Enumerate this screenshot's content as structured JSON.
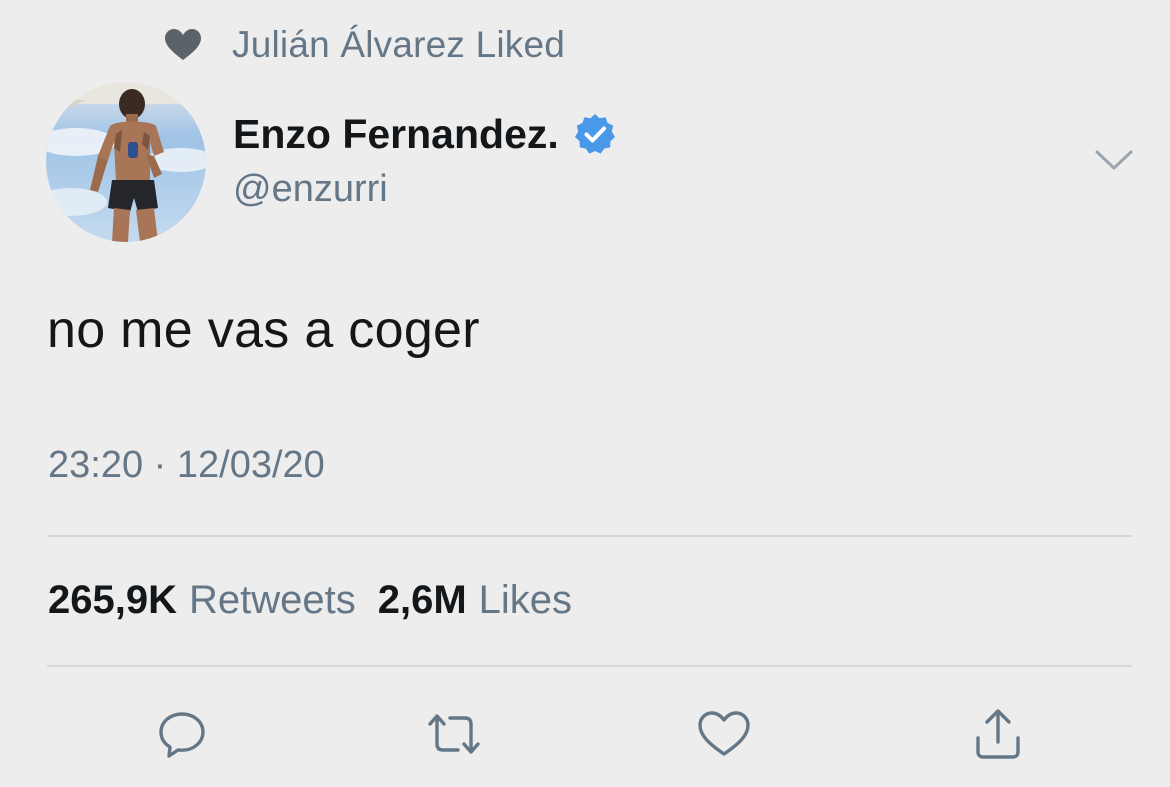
{
  "social_context": {
    "icon": "heart-icon",
    "text": "Julián Álvarez Liked"
  },
  "author": {
    "display_name": "Enzo Fernandez.",
    "handle": "@enzurri",
    "verified": true,
    "verified_color": "#4a99e9",
    "avatar_icon": "avatar-photo"
  },
  "tweet": {
    "text": "no me vas a coger",
    "timestamp": "23:20 · 12/03/20"
  },
  "stats": {
    "retweets_count": "265,9K",
    "retweets_label": "Retweets",
    "likes_count": "2,6M",
    "likes_label": "Likes"
  },
  "actions": [
    {
      "name": "reply",
      "icon": "reply-icon"
    },
    {
      "name": "retweet",
      "icon": "retweet-icon"
    },
    {
      "name": "like",
      "icon": "heart-outline-icon"
    },
    {
      "name": "share",
      "icon": "share-icon"
    }
  ],
  "colors": {
    "background": "#ededed",
    "primary_text": "#14171a",
    "secondary_text": "#657786",
    "divider": "#d4d8dc",
    "icon": "#657786"
  }
}
